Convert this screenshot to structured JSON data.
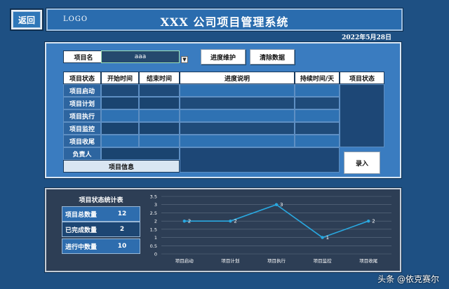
{
  "nav": {
    "back_label": "返回"
  },
  "header": {
    "logo": "LOGO",
    "title": "XXX 公司项目管理系统",
    "date": "2022年5月28日"
  },
  "form": {
    "project_name_label": "项目名",
    "project_name_value": "aaa",
    "progress_button": "进度维护",
    "clear_button": "清除数据",
    "submit_button": "录入"
  },
  "table": {
    "headers": [
      "项目状态",
      "开始时间",
      "结束时间",
      "进度说明",
      "持续时间/天",
      "项目状态"
    ],
    "rows": [
      "项目启动",
      "项目计划",
      "项目执行",
      "项目监控",
      "项目收尾"
    ],
    "owner_label": "负责人",
    "info_label": "项目信息"
  },
  "stats": {
    "title": "项目状态统计表",
    "rows": [
      {
        "label": "项目总数量",
        "value": "12"
      },
      {
        "label": "已完成数量",
        "value": "2"
      },
      {
        "label": "进行中数量",
        "value": "10"
      }
    ]
  },
  "chart_data": {
    "type": "line",
    "categories": [
      "项目启动",
      "项目计划",
      "项目执行",
      "项目监控",
      "项目收尾"
    ],
    "series": [
      {
        "values": [
          2,
          2,
          3,
          1,
          2
        ]
      }
    ],
    "yticks": [
      "0",
      "0.5",
      "1",
      "1.5",
      "2",
      "2.5",
      "3",
      "3.5"
    ],
    "ylim": [
      0,
      3.5
    ],
    "grid": true,
    "color": "#29a8e0"
  },
  "watermark": "头条 @依克赛尔"
}
